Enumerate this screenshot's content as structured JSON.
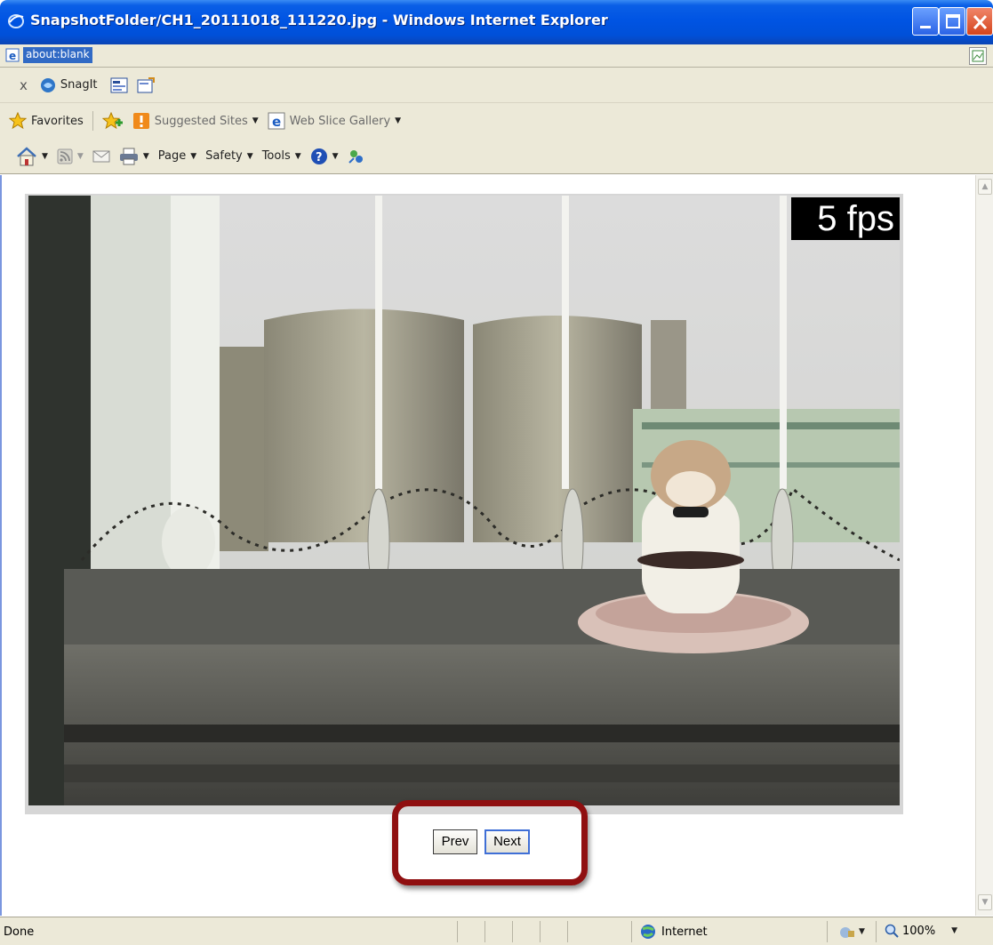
{
  "window": {
    "title": "SnapshotFolder/CH1_20111018_111220.jpg - Windows Internet Explorer"
  },
  "address": {
    "url": "about:blank"
  },
  "toolbar_snagit": {
    "close": "x",
    "snagit_label": "SnagIt"
  },
  "favorites_bar": {
    "favorites_label": "Favorites",
    "suggested_sites_label": "Suggested Sites",
    "web_slice_label": "Web Slice Gallery"
  },
  "command_bar": {
    "page_label": "Page",
    "safety_label": "Safety",
    "tools_label": "Tools"
  },
  "content": {
    "fps_label": "5 fps",
    "prev_label": "Prev",
    "next_label": "Next"
  },
  "status": {
    "text": "Done",
    "zone": "Internet",
    "zoom": "100%"
  },
  "colors": {
    "titlebar": "#0054e3",
    "chrome": "#ece9d8",
    "highlight": "#8f0f10",
    "selection": "#316ac5"
  }
}
